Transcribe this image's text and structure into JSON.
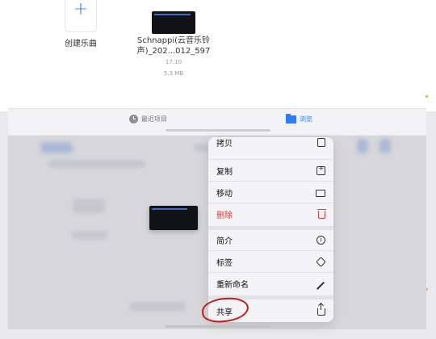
{
  "files": {
    "create_label": "创建乐曲",
    "file_name_line1": "Schnappi(云音乐铃",
    "file_name_line2": "声)_202...012_597",
    "file_time": "17:10",
    "file_size": "5.3 MB"
  },
  "tabbar": {
    "recent": "最近项目",
    "browse": "浏览"
  },
  "context_menu": {
    "items": [
      {
        "label": "拷贝",
        "icon": "copy-to-icon"
      },
      {
        "label": "复制",
        "icon": "duplicate-icon"
      },
      {
        "label": "移动",
        "icon": "folder-icon"
      },
      {
        "label": "删除",
        "icon": "trash-icon"
      },
      {
        "label": "简介",
        "icon": "info-icon"
      },
      {
        "label": "标签",
        "icon": "tag-icon"
      },
      {
        "label": "重新命名",
        "icon": "pencil-icon"
      },
      {
        "label": "共享",
        "icon": "share-icon"
      }
    ]
  },
  "colors": {
    "accent": "#2f7cf6",
    "danger": "#e3393b",
    "annotation": "#c91818"
  }
}
